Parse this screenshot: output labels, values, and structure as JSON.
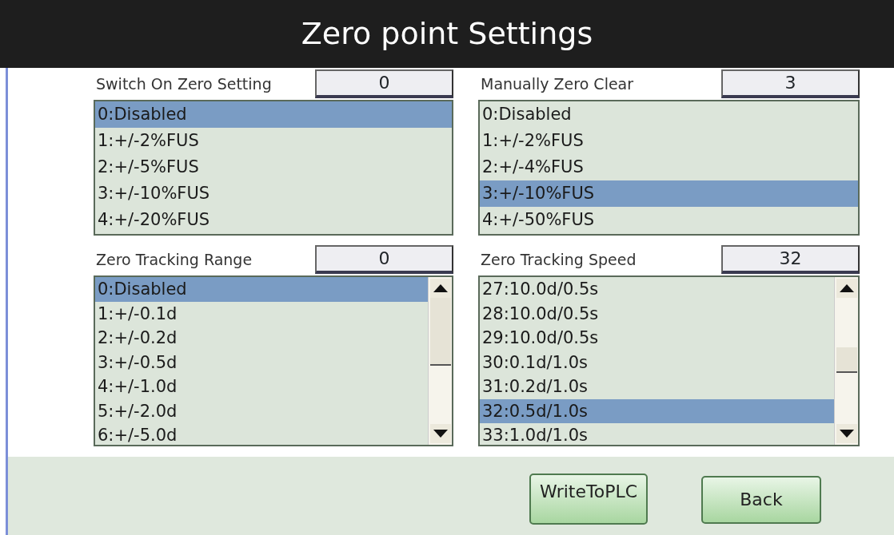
{
  "title": "Zero point Settings",
  "sections": [
    {
      "label": "Switch On Zero Setting",
      "value": "0",
      "scrollable": false,
      "options": [
        {
          "text": "0:Disabled",
          "selected": true
        },
        {
          "text": "1:+/-2%FUS",
          "selected": false
        },
        {
          "text": "2:+/-5%FUS",
          "selected": false
        },
        {
          "text": "3:+/-10%FUS",
          "selected": false
        },
        {
          "text": "4:+/-20%FUS",
          "selected": false
        }
      ]
    },
    {
      "label": "Manually Zero Clear",
      "value": "3",
      "scrollable": false,
      "options": [
        {
          "text": "0:Disabled",
          "selected": false
        },
        {
          "text": "1:+/-2%FUS",
          "selected": false
        },
        {
          "text": "2:+/-4%FUS",
          "selected": false
        },
        {
          "text": "3:+/-10%FUS",
          "selected": true
        },
        {
          "text": "4:+/-50%FUS",
          "selected": false
        }
      ]
    },
    {
      "label": "Zero Tracking Range",
      "value": "0",
      "scrollable": true,
      "options": [
        {
          "text": "0:Disabled",
          "selected": true
        },
        {
          "text": "1:+/-0.1d",
          "selected": false
        },
        {
          "text": "2:+/-0.2d",
          "selected": false
        },
        {
          "text": "3:+/-0.5d",
          "selected": false
        },
        {
          "text": "4:+/-1.0d",
          "selected": false
        },
        {
          "text": "5:+/-2.0d",
          "selected": false
        },
        {
          "text": "6:+/-5.0d",
          "selected": false
        }
      ]
    },
    {
      "label": "Zero Tracking Speed",
      "value": "32",
      "scrollable": true,
      "options": [
        {
          "text": "27:10.0d/0.5s",
          "selected": false
        },
        {
          "text": "28:10.0d/0.5s",
          "selected": false
        },
        {
          "text": "29:10.0d/0.5s",
          "selected": false
        },
        {
          "text": "30:0.1d/1.0s",
          "selected": false
        },
        {
          "text": "31:0.2d/1.0s",
          "selected": false
        },
        {
          "text": "32:0.5d/1.0s",
          "selected": true
        },
        {
          "text": "33:1.0d/1.0s",
          "selected": false
        }
      ]
    }
  ],
  "buttons": [
    {
      "label": "WriteToPLC"
    },
    {
      "label": "Back"
    }
  ]
}
